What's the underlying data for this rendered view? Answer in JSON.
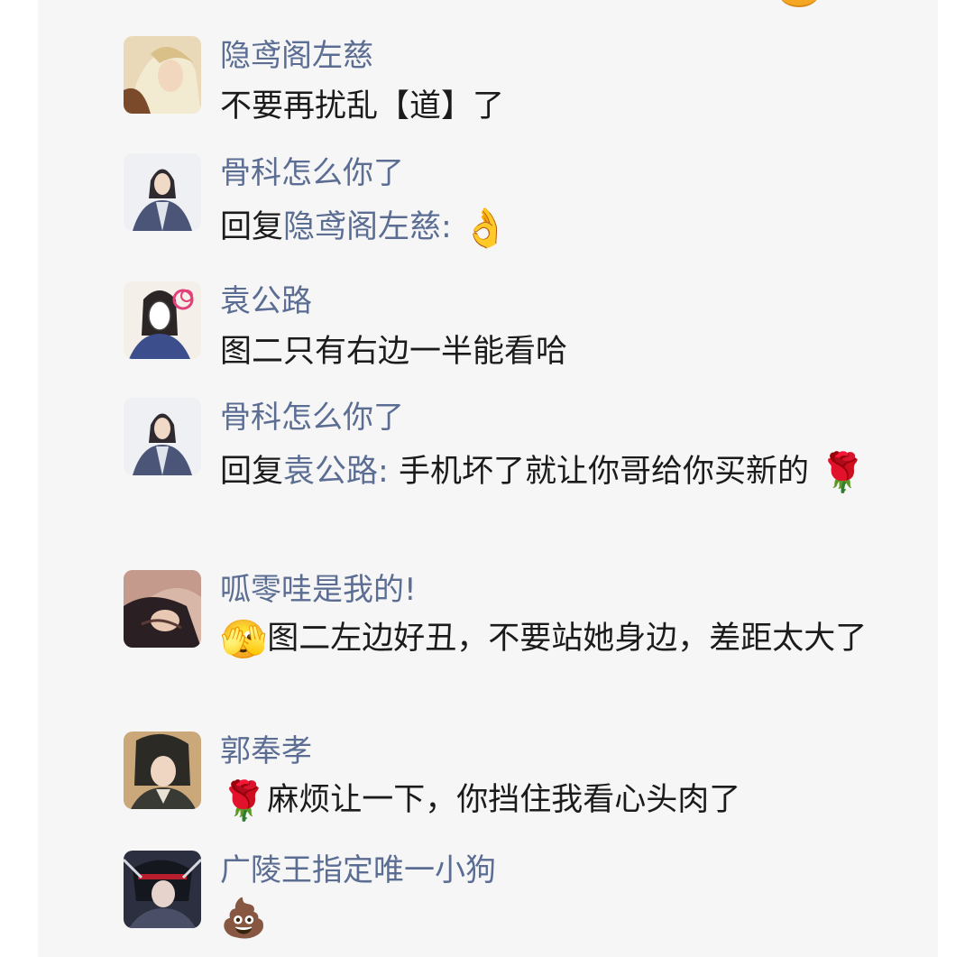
{
  "comments": [
    {
      "username": "隐鸢阁左慈",
      "text": "不要再扰乱【道】了",
      "avatar_colors": [
        "#e9d9b8",
        "#c29a62",
        "#7a4a2a"
      ]
    },
    {
      "username": "骨科怎么你了",
      "reply_prefix": "回复",
      "reply_target": "隐鸢阁左慈:",
      "text": "",
      "emoji": "👌",
      "avatar_colors": [
        "#eef0f4",
        "#4b5578",
        "#2e2a30"
      ]
    },
    {
      "username": "袁公路",
      "text": "图二只有右边一半能看哈",
      "avatar_colors": [
        "#f4efe8",
        "#3c4f8c",
        "#e2407a"
      ]
    },
    {
      "username": "骨科怎么你了",
      "reply_prefix": "回复",
      "reply_target": "袁公路:",
      "text": " 手机坏了就让你哥给你买新的",
      "emoji": "🌹",
      "avatar_colors": [
        "#eef0f4",
        "#4b5578",
        "#2e2a30"
      ]
    },
    {
      "username": "呱零哇是我的!",
      "lead_emoji": "🫣",
      "text": "图二左边好丑，不要站她身边，差距太大了",
      "avatar_colors": [
        "#d9b7a8",
        "#5a3a34",
        "#2a1f22"
      ]
    },
    {
      "username": "郭奉孝",
      "lead_emoji": "🌹",
      "text": "麻烦让一下，你挡住我看心头肉了",
      "avatar_colors": [
        "#caa87a",
        "#2c2a24",
        "#6d7a5a"
      ]
    },
    {
      "username": "广陵王指定唯一小狗",
      "text": "",
      "emoji": "💩",
      "avatar_colors": [
        "#2b2f3f",
        "#b81e2e",
        "#d8d8e0"
      ]
    }
  ]
}
